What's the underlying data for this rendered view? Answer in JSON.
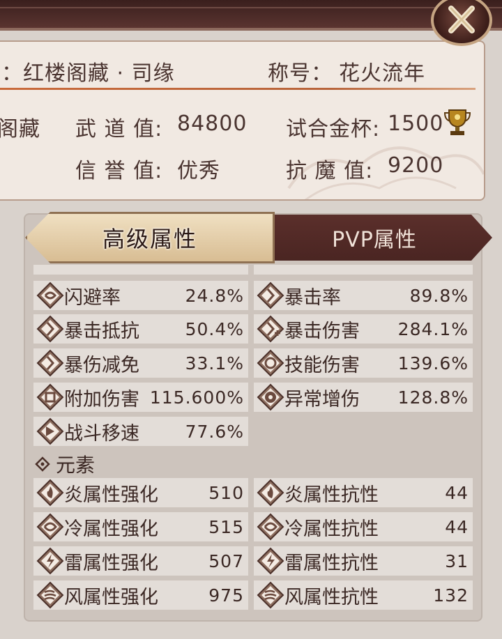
{
  "header": {
    "name_label": "：红楼阁藏 · 司缘",
    "title_label": "称号：",
    "title_value": "花火流年",
    "guild": "阁藏",
    "martial_label": "武 道 值:",
    "martial_value": "84800",
    "trial_label": "试合金杯:",
    "trial_value": "1500",
    "honor_label": "信 誉 值:",
    "honor_value": "优秀",
    "demon_label": "抗 魔 值:",
    "demon_value": "9200"
  },
  "tabs": {
    "advanced": "高级属性",
    "pvp": "PVP属性"
  },
  "stats_left": [
    {
      "name": "闪避率",
      "value": "24.8%",
      "icon": "dodge-icon"
    },
    {
      "name": "暴击抵抗",
      "value": "50.4%",
      "icon": "crit-resist-icon"
    },
    {
      "name": "暴伤减免",
      "value": "33.1%",
      "icon": "crit-dmg-reduce-icon"
    },
    {
      "name": "附加伤害",
      "value": "115.600%",
      "icon": "extra-damage-icon"
    },
    {
      "name": "战斗移速",
      "value": "77.6%",
      "icon": "move-speed-icon"
    }
  ],
  "stats_right": [
    {
      "name": "暴击率",
      "value": "89.8%",
      "icon": "crit-rate-icon"
    },
    {
      "name": "暴击伤害",
      "value": "284.1%",
      "icon": "crit-damage-icon"
    },
    {
      "name": "技能伤害",
      "value": "139.6%",
      "icon": "skill-damage-icon"
    },
    {
      "name": "异常增伤",
      "value": "128.8%",
      "icon": "abnormal-damage-icon"
    }
  ],
  "elements_title": "元素",
  "elements": [
    {
      "name": "炎属性强化",
      "value": "510",
      "res_name": "炎属性抗性",
      "res_value": "44"
    },
    {
      "name": "冷属性强化",
      "value": "515",
      "res_name": "冷属性抗性",
      "res_value": "44"
    },
    {
      "name": "雷属性强化",
      "value": "507",
      "res_name": "雷属性抗性",
      "res_value": "31"
    },
    {
      "name": "风属性强化",
      "value": "975",
      "res_name": "风属性抗性",
      "res_value": "132"
    }
  ],
  "colors": {
    "accent": "#c96a3a",
    "tab_active": "#d8bd93",
    "tab_inactive": "#4a2522"
  }
}
